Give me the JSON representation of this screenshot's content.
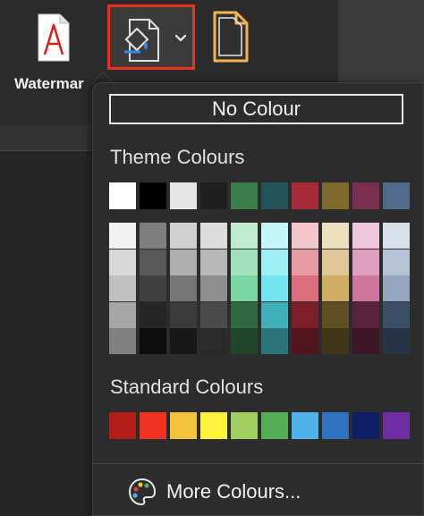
{
  "ribbon": {
    "watermark_label": "Watermar",
    "page_color_icon": "paint-bucket-icon",
    "page_borders_icon": "page-borders-icon",
    "watermark_icon": "watermark-icon"
  },
  "menu": {
    "no_colour_label": "No Colour",
    "theme_title": "Theme Colours",
    "standard_title": "Standard Colours",
    "more_colours_label": "More Colours...",
    "more_colours_icon": "palette-icon"
  },
  "theme_colors": [
    "#ffffff",
    "#000000",
    "#e6e6e6",
    "#1f1f1f",
    "#3a7d4a",
    "#22545a",
    "#a52a3a",
    "#7f6a2e",
    "#7a2e4f",
    "#4f6a8a"
  ],
  "theme_shades": [
    [
      "#f2f2f2",
      "#d9d9d9",
      "#bfbfbf",
      "#a6a6a6",
      "#808080"
    ],
    [
      "#7f7f7f",
      "#595959",
      "#404040",
      "#262626",
      "#0d0d0d"
    ],
    [
      "#d0d0d0",
      "#aeaeae",
      "#757575",
      "#3a3a3a",
      "#171717"
    ],
    [
      "#dcdcdc",
      "#b8b8b8",
      "#8f8f8f",
      "#4a4a4a",
      "#2a2a2a"
    ],
    [
      "#bfeccf",
      "#a0e2bb",
      "#78d6a0",
      "#2f6a3e",
      "#1f4629"
    ],
    [
      "#c4f7fa",
      "#9ef0f6",
      "#72e6f0",
      "#3fb0b8",
      "#2a7579"
    ],
    [
      "#f3c6cc",
      "#e89aa5",
      "#dc6d7d",
      "#7c1f2c",
      "#52141d"
    ],
    [
      "#ede0bf",
      "#e0c898",
      "#cfad62",
      "#5f5023",
      "#3f3517"
    ],
    [
      "#efc8dc",
      "#dfa0bf",
      "#cf769f",
      "#5b223b",
      "#3d1727"
    ],
    [
      "#d8e0ea",
      "#b6c3d4",
      "#93a6bd",
      "#3b4f68",
      "#273445"
    ]
  ],
  "standard_colors": [
    "#b11e17",
    "#ef3223",
    "#f3c23b",
    "#fff33a",
    "#a0cf5d",
    "#55ae55",
    "#4fb3ea",
    "#2f71c1",
    "#0d1e62",
    "#6e2ea3"
  ]
}
